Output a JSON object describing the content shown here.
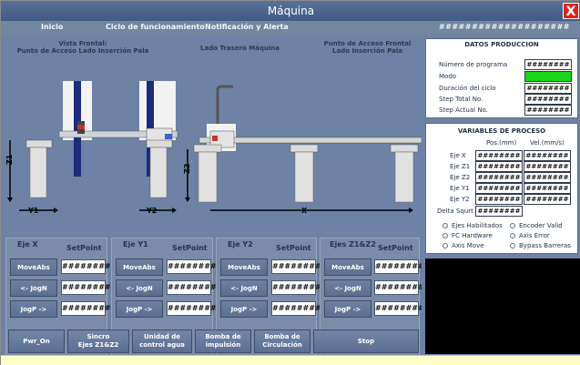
{
  "window": {
    "title": "Máquina",
    "close_label": "X"
  },
  "menu": {
    "items": [
      "Inicio",
      "Ciclo de funcionamiento",
      "Notificación y Alerta"
    ],
    "code": "####################"
  },
  "views": {
    "front": "Vista Frontal:\nPunto de Acceso Lado Inserción Pala",
    "back": "Lado Trasero Máquina",
    "front2": "Punto de Acceso Frontal\nLado Inserción Pala"
  },
  "axes_labels": {
    "y1": "Y1",
    "y2": "Y2",
    "z1": "Z1",
    "z2": "Z2",
    "x": "X"
  },
  "panels": [
    {
      "title": "Eje X",
      "setpoint": "SetPoint",
      "buttons": [
        "MoveAbs",
        "<- JogN",
        "JogP ->"
      ],
      "values": [
        "########",
        "########",
        "########"
      ]
    },
    {
      "title": "Eje Y1",
      "setpoint": "SetPoint",
      "buttons": [
        "MoveAbs",
        "<- JogN",
        "JogP ->"
      ],
      "values": [
        "########",
        "########",
        "########"
      ]
    },
    {
      "title": "Eje Y2",
      "setpoint": "SetPoint",
      "buttons": [
        "MoveAbs",
        "<- JogN",
        "JogP ->"
      ],
      "values": [
        "########",
        "########",
        "########"
      ]
    },
    {
      "title": "Ejes Z1&Z2",
      "setpoint": "SetPoint",
      "buttons": [
        "MoveAbs",
        "<- JogN",
        "JogP ->"
      ],
      "values": [
        "########",
        "########",
        "########"
      ]
    }
  ],
  "bottom_buttons": [
    "Pwr_On",
    "Sincro\nEjes Z1&Z2",
    "Unidad de\ncontrol agua",
    "Bomba de\nimpulsión",
    "Bomba de\nCirculación",
    "Stop"
  ],
  "produccion": {
    "title": "DATOS PRODUCCION",
    "rows": [
      {
        "label": "Número de programa",
        "value": "########"
      },
      {
        "label": "Modo",
        "value": ""
      },
      {
        "label": "Duración del ciclo",
        "value": "########"
      },
      {
        "label": "Step Total No.",
        "value": "########"
      },
      {
        "label": "Step Actual No.",
        "value": "########"
      }
    ],
    "mode_color": "#1bd41b"
  },
  "proceso": {
    "title": "VARIABLES DE PROCESO",
    "col_pos": "Pos.(mm)",
    "col_vel": "Vel.(mm/s)",
    "rows": [
      {
        "label": "Eje X",
        "pos": "########",
        "vel": "########"
      },
      {
        "label": "Eje Z1",
        "pos": "########",
        "vel": "########"
      },
      {
        "label": "Eje Z2",
        "pos": "########",
        "vel": "########"
      },
      {
        "label": "Eje Y1",
        "pos": "########",
        "vel": "########"
      },
      {
        "label": "Eje Y2",
        "pos": "########",
        "vel": "########"
      }
    ],
    "delta_label": "Delta Squrt",
    "delta_value": "########",
    "status": [
      "Ejes Habilitados",
      "Encoder Valid",
      "FC Hardware",
      "Axis Error",
      "Axis Move",
      "Bypass Barreras"
    ]
  }
}
